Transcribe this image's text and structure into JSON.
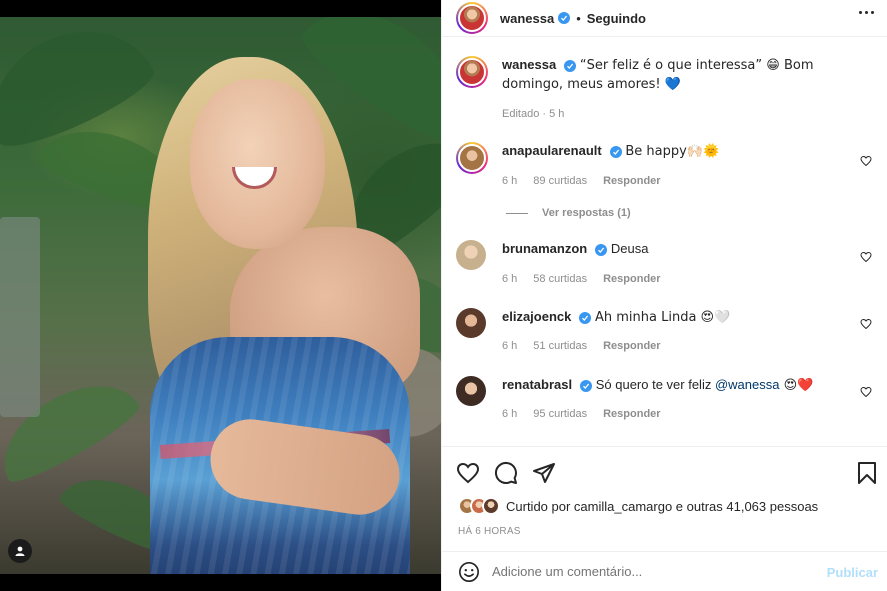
{
  "post": {
    "author": "wanessa",
    "follow_status": "Seguindo",
    "separator": "•",
    "caption": "“Ser feliz é o que interessa” 😁 Bom domingo, meus amores! 💙",
    "caption_meta": "Editado · 5 h"
  },
  "comments": [
    {
      "user": "anapaularenault",
      "verified": true,
      "text": "Be happy🙌🏻🌞",
      "time": "6 h",
      "likes": "89 curtidas",
      "reply": "Responder",
      "view_replies": "Ver respostas (1)"
    },
    {
      "user": "brunamanzon",
      "verified": true,
      "text": "Deusa",
      "time": "6 h",
      "likes": "58 curtidas",
      "reply": "Responder"
    },
    {
      "user": "elizajoenck",
      "verified": true,
      "text": "Ah minha Linda 😍🤍",
      "time": "6 h",
      "likes": "51 curtidas",
      "reply": "Responder"
    },
    {
      "user": "renatabrasl",
      "verified": true,
      "text_before": "Só quero te ver feliz ",
      "mention": "@wanessa",
      "text_after": " 😍❤️",
      "time": "6 h",
      "likes": "95 curtidas",
      "reply": "Responder"
    }
  ],
  "likes": {
    "text": "Curtido por camilla_camargo e outras 41,063 pessoas"
  },
  "time_ago": "HÁ 6 HORAS",
  "add_comment": {
    "placeholder": "Adicione um comentário...",
    "publish": "Publicar"
  },
  "icons": {
    "like": "heart-icon",
    "comment": "comment-icon",
    "share": "paper-plane-icon",
    "save": "bookmark-icon",
    "emoji": "smiley-icon",
    "more": "more-icon",
    "tag": "user-tag-icon"
  }
}
